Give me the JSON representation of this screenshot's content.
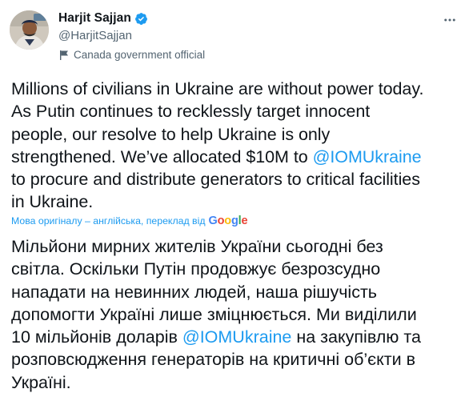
{
  "author": {
    "name": "Harjit Sajjan",
    "handle": "@HarjitSajjan",
    "official_label": "Canada government official"
  },
  "icons": {
    "verified": "verified-badge-icon",
    "flag": "government-flag-icon",
    "more": "more-options-icon"
  },
  "colors": {
    "link": "#1d9bf0",
    "secondary_text": "#536471",
    "verified": "#1d9bf0"
  },
  "tweet": {
    "lines": [
      [
        "Millions of civilians in Ukraine are without power today."
      ],
      [
        "As Putin continues to recklessly target innocent"
      ],
      [
        "people, our resolve to help Ukraine is only"
      ],
      [
        "strengthened. We’ve allocated $10M to "
      ],
      [
        "to procure and distribute generators to critical facilities"
      ],
      [
        "in Ukraine."
      ]
    ],
    "mention": "@IOMUkraine"
  },
  "translation": {
    "note": "Мова оригіналу – англійська, переклад від",
    "provider": "Google",
    "lines": [
      "Мільйони мирних жителів України сьогодні без",
      "світла. Оскільки Путін продовжує безрозсудно",
      "нападати на невинних людей, наша рішучість",
      "допомогти Україні лише зміцнюється. Ми виділили",
      "10 мільйонів доларів ",
      " на закупівлю та",
      "розповсюдження генераторів на критичні об’єкти в",
      "Україні."
    ],
    "mention": "@IOMUkraine"
  }
}
